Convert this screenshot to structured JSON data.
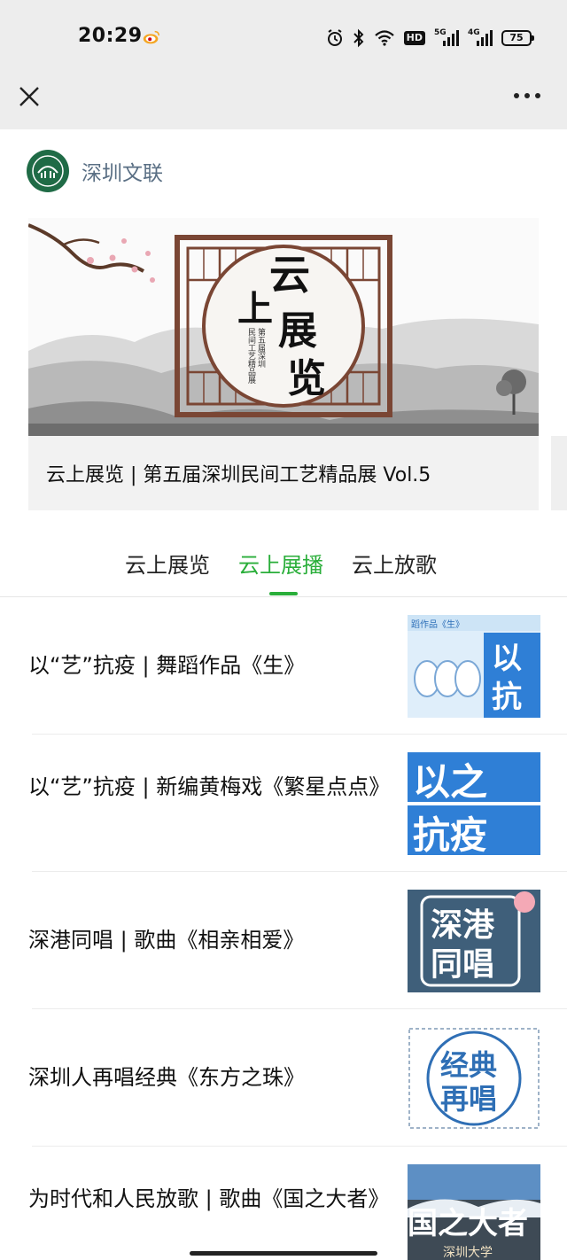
{
  "status_bar": {
    "time": "20:29",
    "network_1": "5G",
    "network_2": "4G",
    "hd_label": "HD",
    "battery": "75",
    "icons": [
      "weibo-icon",
      "alarm-icon",
      "bluetooth-icon",
      "wifi-icon",
      "hd-icon",
      "signal-5g-icon",
      "signal-4g-icon",
      "battery-icon"
    ]
  },
  "nav": {
    "close_icon": "close-icon",
    "more_icon": "more-icon"
  },
  "account": {
    "name": "深圳文联"
  },
  "banner": {
    "art": {
      "char_yun": "云",
      "char_shang": "上",
      "char_zhan": "展",
      "char_lan": "览",
      "sub_line1": "第五届深圳",
      "sub_line2": "民间工艺精品展"
    },
    "caption": "云上展览 | 第五届深圳民间工艺精品展 Vol.5"
  },
  "tabs": [
    {
      "label": "云上展览",
      "active": false
    },
    {
      "label": "云上展播",
      "active": true
    },
    {
      "label": "云上放歌",
      "active": false
    }
  ],
  "colors": {
    "accent": "#2aae3a",
    "account_name": "#5a6f84",
    "chrome_bg": "#ededed"
  },
  "list": [
    {
      "title": "以“艺”抗疫 | 舞蹈作品《生》",
      "thumb": {
        "tag": "蹈作品《生》",
        "line1": "以",
        "line2": "抗"
      }
    },
    {
      "title": "以“艺”抗疫 | 新编黄梅戏《繁星点点》",
      "thumb": {
        "line1": "以之",
        "line2": "抗疫"
      }
    },
    {
      "title": "深港同唱 | 歌曲《相亲相爱》",
      "thumb": {
        "line1": "深港",
        "line2": "同唱"
      }
    },
    {
      "title": "深圳人再唱经典《东方之珠》",
      "thumb": {
        "line1": "经典",
        "line2": "再唱"
      }
    },
    {
      "title": "为时代和人民放歌 | 歌曲《国之大者》",
      "thumb": {
        "big": "国之大者",
        "watermark": "深圳大学"
      }
    }
  ]
}
